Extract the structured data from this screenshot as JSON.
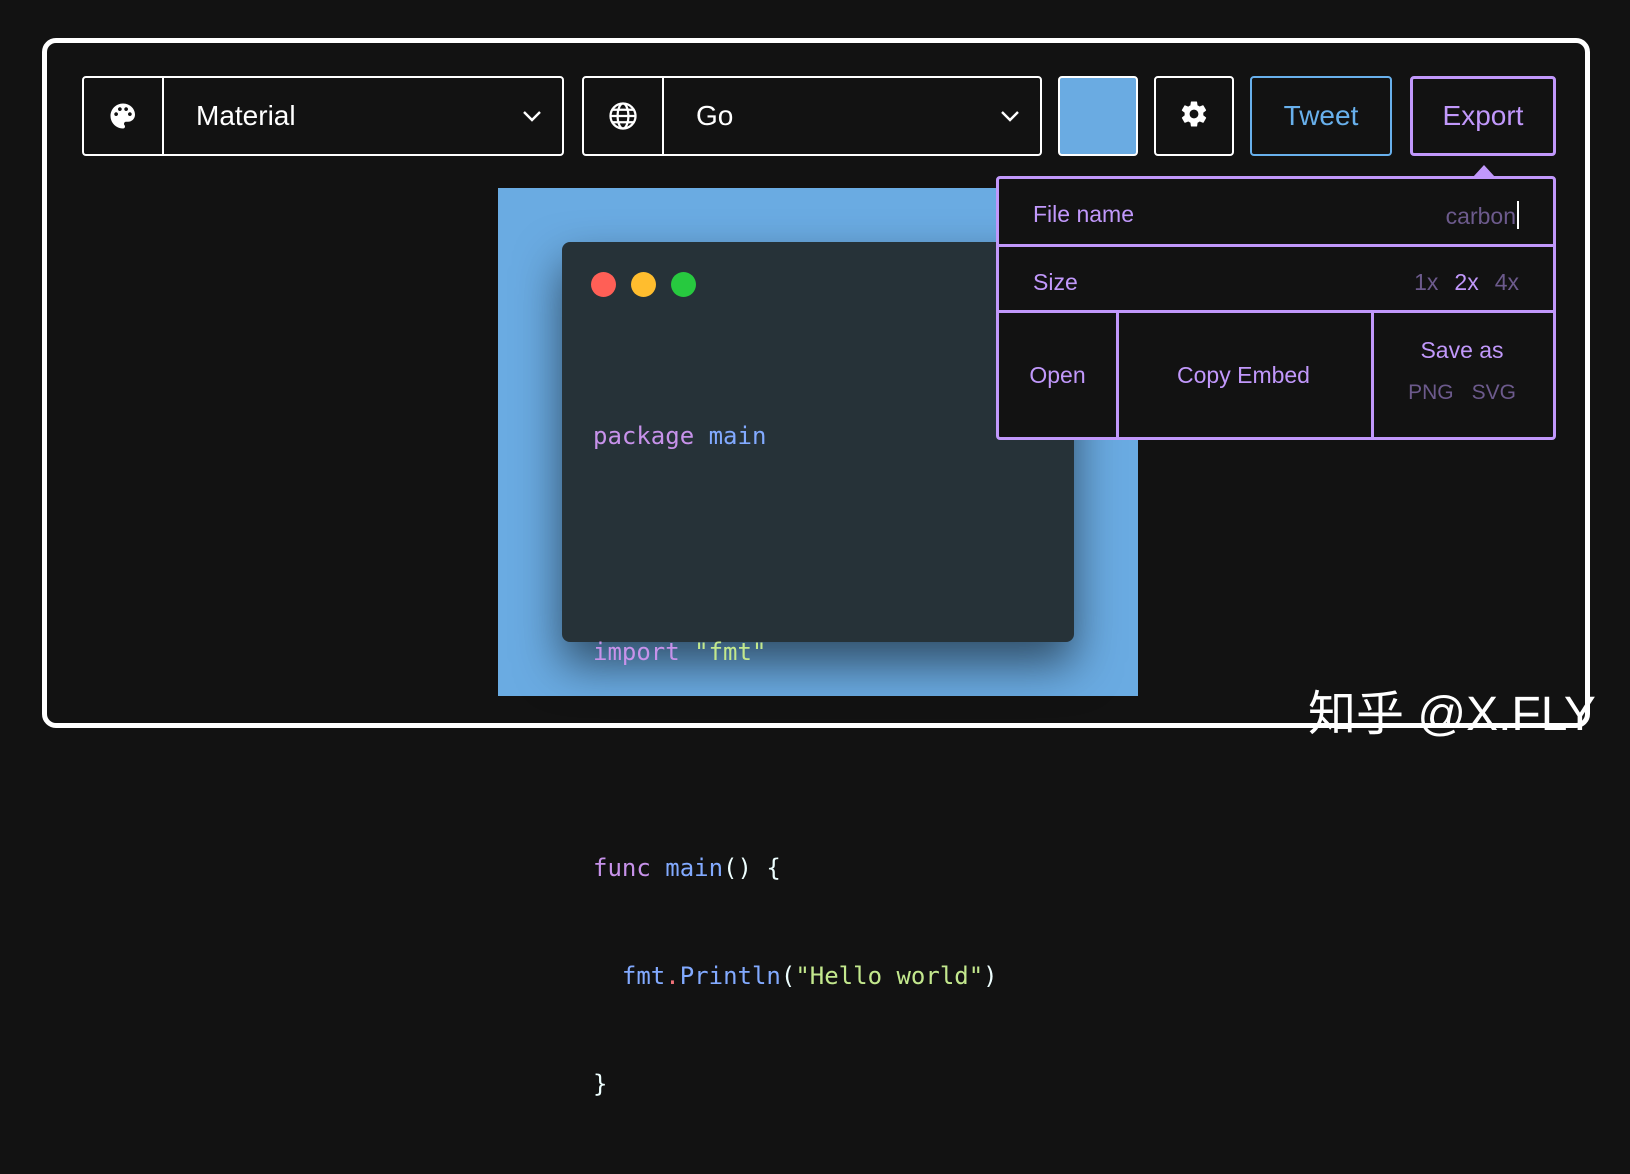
{
  "toolbar": {
    "theme_label": "Material",
    "language_label": "Go",
    "background_color": "#6aabe2",
    "tweet_label": "Tweet",
    "export_label": "Export"
  },
  "icons": {
    "theme": "palette-icon",
    "language": "globe-icon",
    "settings": "gear-icon",
    "dropdown": "chevron-down-icon"
  },
  "window_controls": [
    "#ff5f56",
    "#ffbd2e",
    "#27c93f"
  ],
  "code": {
    "line1_kw": "package",
    "line1_name": "main",
    "line3_kw": "import",
    "line3_str": "\"fmt\"",
    "line5_kw": "func",
    "line5_fn": "main",
    "line5_rest": "() {",
    "line6_indent": "  ",
    "line6_pkg": "fmt",
    "line6_dot": ".",
    "line6_fn": "Println",
    "line6_open": "(",
    "line6_str": "\"Hello world\"",
    "line6_close": ")",
    "line7": "}"
  },
  "export_panel": {
    "file_name_label": "File name",
    "file_name_value": "carbon",
    "size_label": "Size",
    "size_options": [
      "1x",
      "2x",
      "4x"
    ],
    "size_selected": "2x",
    "open_label": "Open",
    "copy_embed_label": "Copy Embed",
    "save_as_label": "Save as",
    "save_formats": [
      "PNG",
      "SVG"
    ]
  },
  "colors": {
    "accent_purple": "#c198fb",
    "tweet_blue": "#68b0ec",
    "code_bg": "#263238"
  },
  "watermark": "知乎 @X.FLY"
}
